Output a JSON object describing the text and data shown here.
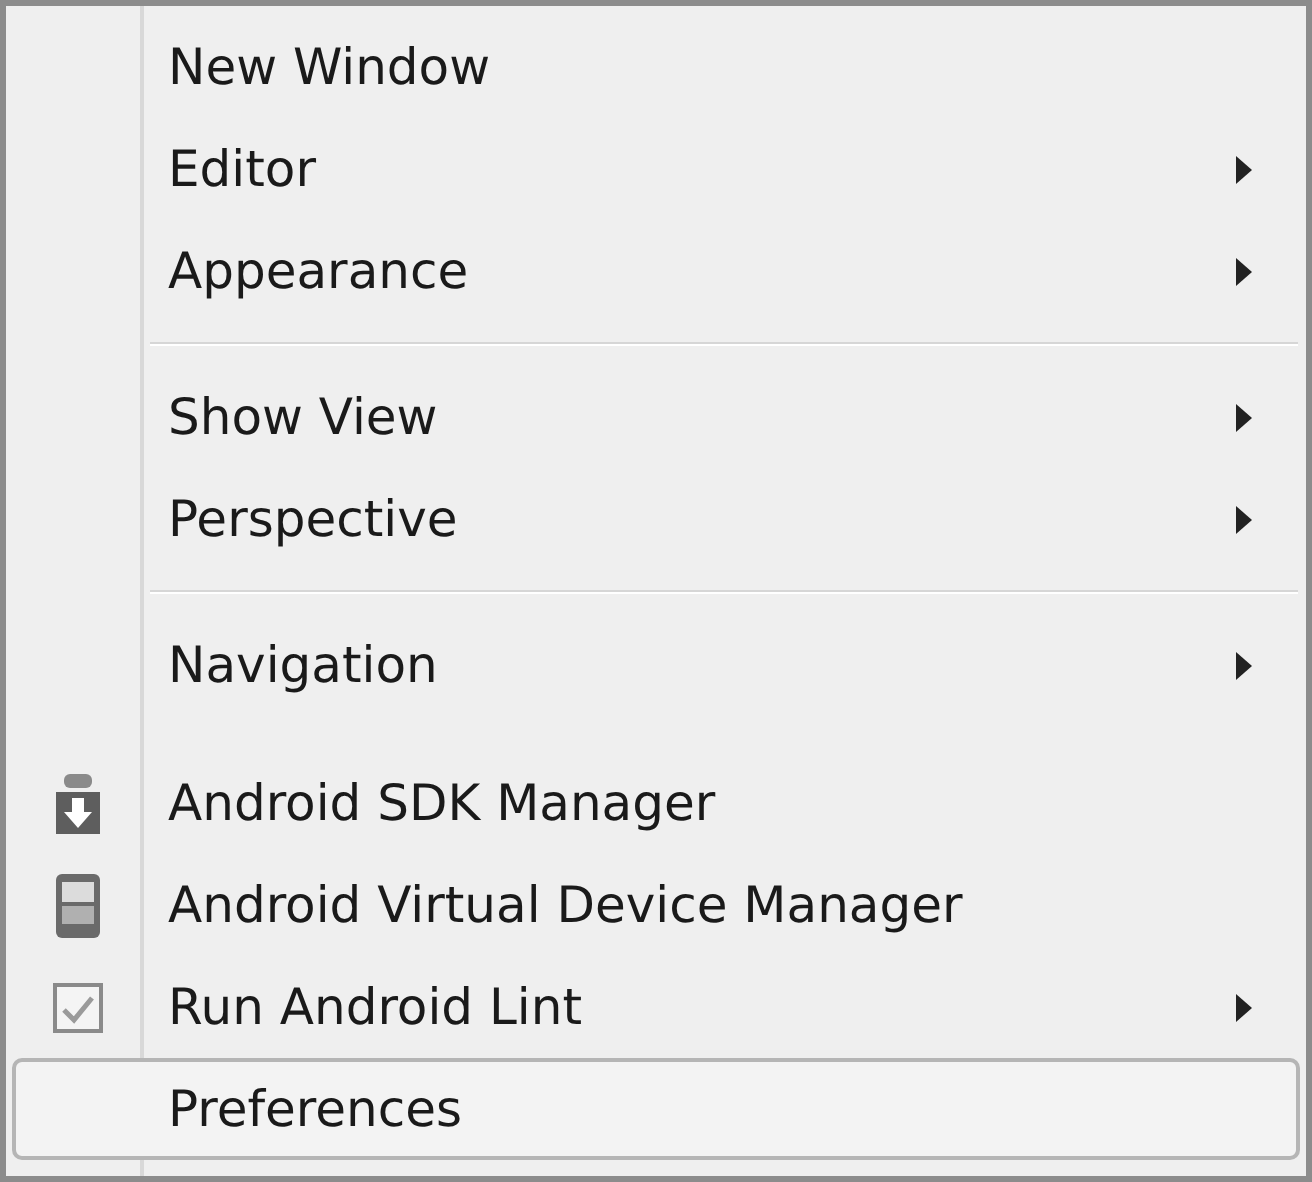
{
  "menu": {
    "groups": [
      {
        "items": [
          {
            "label": "New Window",
            "submenu": false,
            "selected": false
          },
          {
            "label": "Editor",
            "submenu": true,
            "selected": false
          },
          {
            "label": "Appearance",
            "submenu": true,
            "selected": false
          }
        ]
      },
      {
        "items": [
          {
            "label": "Show View",
            "submenu": true,
            "selected": false
          },
          {
            "label": "Perspective",
            "submenu": true,
            "selected": false
          }
        ]
      },
      {
        "items": [
          {
            "label": "Navigation",
            "submenu": true,
            "selected": false
          }
        ]
      },
      {
        "items": [
          {
            "label": "Android SDK Manager",
            "submenu": false,
            "kind": "sdk",
            "selected": false
          },
          {
            "label": "Android Virtual Device Manager",
            "submenu": false,
            "kind": "avd",
            "selected": false
          },
          {
            "label": "Run Android Lint",
            "submenu": true,
            "kind": "lint",
            "selected": false
          },
          {
            "label": "Preferences",
            "submenu": false,
            "selected": true
          }
        ]
      }
    ]
  }
}
